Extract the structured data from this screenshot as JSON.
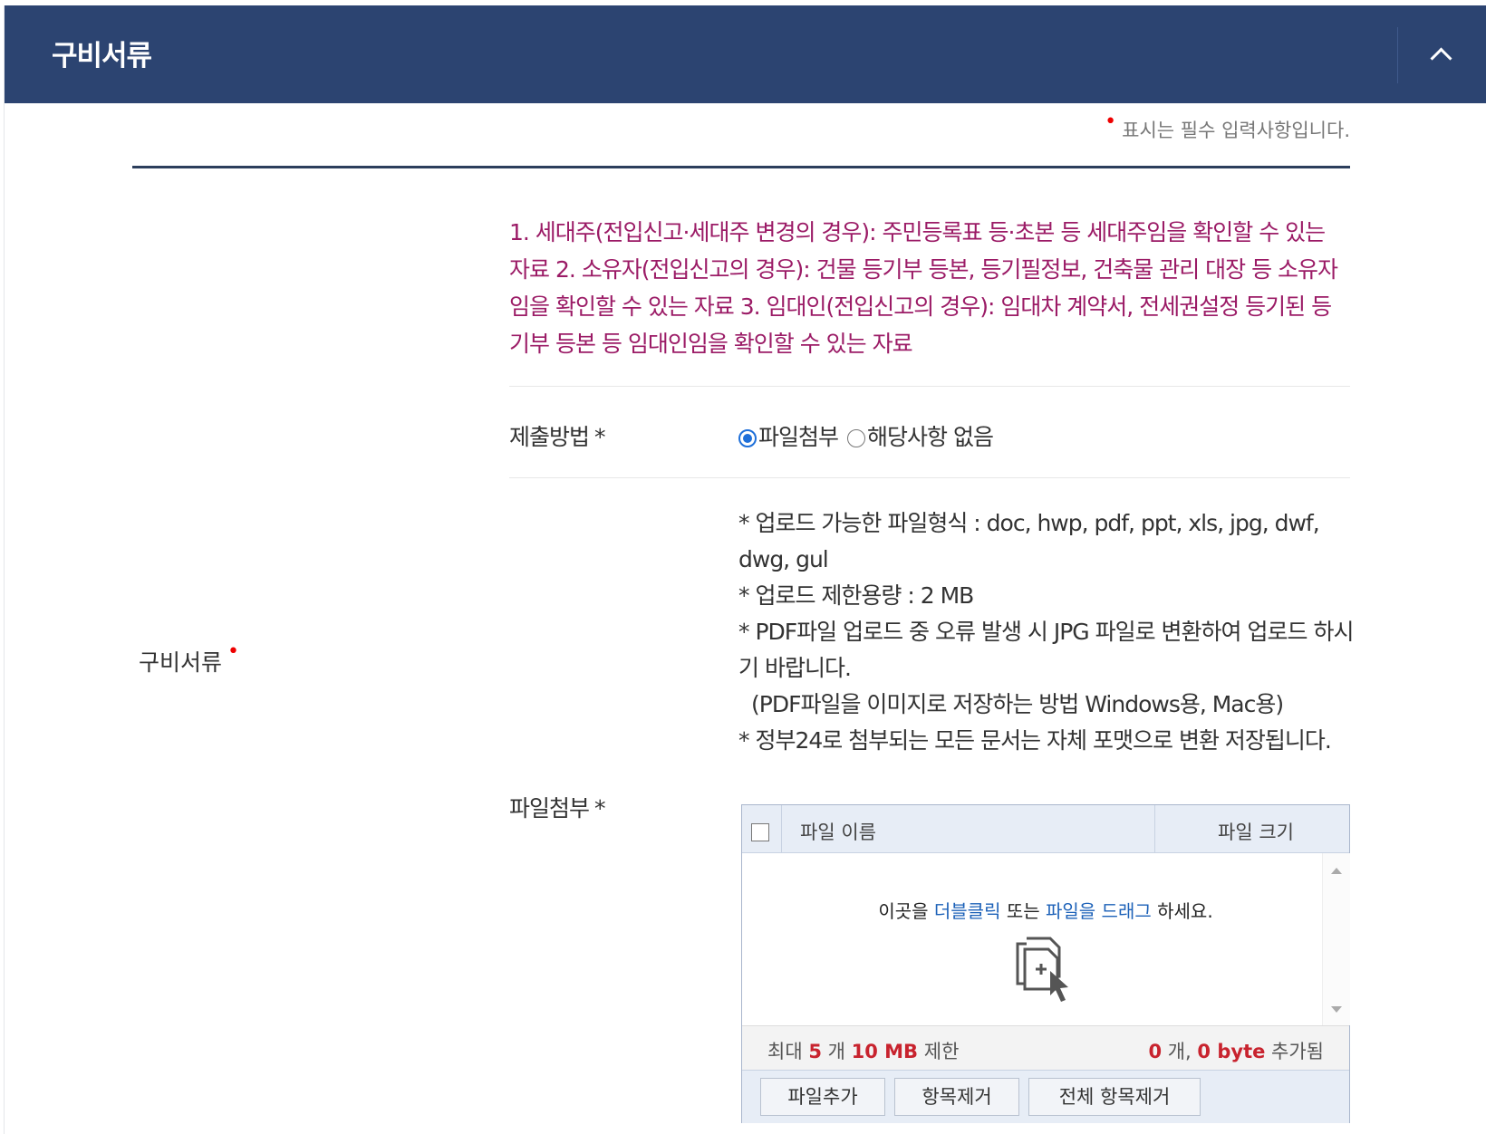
{
  "header": {
    "title": "구비서류",
    "collapse_icon": "chevron-up-icon"
  },
  "required_note": {
    "marker": "•",
    "text": "표시는 필수 입력사항입니다."
  },
  "section_label": "구비서류",
  "notice": "1. 세대주(전입신고·세대주 변경의 경우): 주민등록표 등·초본 등 세대주임을 확인할 수 있는 자료 2. 소유자(전입신고의 경우): 건물 등기부 등본, 등기필정보, 건축물 관리 대장 등 소유자임을 확인할 수 있는 자료 3. 임대인(전입신고의 경우): 임대차 계약서, 전세권설정 등기된 등기부 등본 등 임대인임을 확인할 수 있는 자료",
  "submit_method": {
    "label": "제출방법",
    "required_mark": "*",
    "options": [
      {
        "label": "파일첨부",
        "selected": true
      },
      {
        "label": "해당사항 없음",
        "selected": false
      }
    ]
  },
  "attachment": {
    "label": "파일첨부",
    "required_mark": "*",
    "info_lines": [
      "* 업로드 가능한 파일형식 : doc, hwp, pdf, ppt, xls, jpg, dwf, dwg, gul",
      "* 업로드 제한용량 : 2 MB",
      "* PDF파일 업로드 중 오류 발생 시 JPG 파일로 변환하여 업로드 하시기 바랍니다.",
      " (PDF파일을 이미지로 저장하는 방법  Windows용, Mac용)",
      "* 정부24로 첨부되는 모든 문서는 자체 포맷으로 변환 저장됩니다."
    ],
    "uploader": {
      "col_name": "파일 이름",
      "col_size": "파일 크기",
      "drop_msg_1": "이곳을 ",
      "drop_msg_link1": "더블클릭",
      "drop_msg_2": " 또는 ",
      "drop_msg_link2": "파일을 드래그",
      "drop_msg_3": " 하세요.",
      "limit_prefix": "최대 ",
      "limit_count": "5",
      "limit_mid": " 개 ",
      "limit_size": "10 MB",
      "limit_suffix": " 제한",
      "added_count": "0",
      "added_mid": " 개, ",
      "added_size": "0 byte",
      "added_suffix": " 추가됨",
      "buttons": {
        "add": "파일추가",
        "remove": "항목제거",
        "remove_all": "전체 항목제거"
      }
    }
  }
}
